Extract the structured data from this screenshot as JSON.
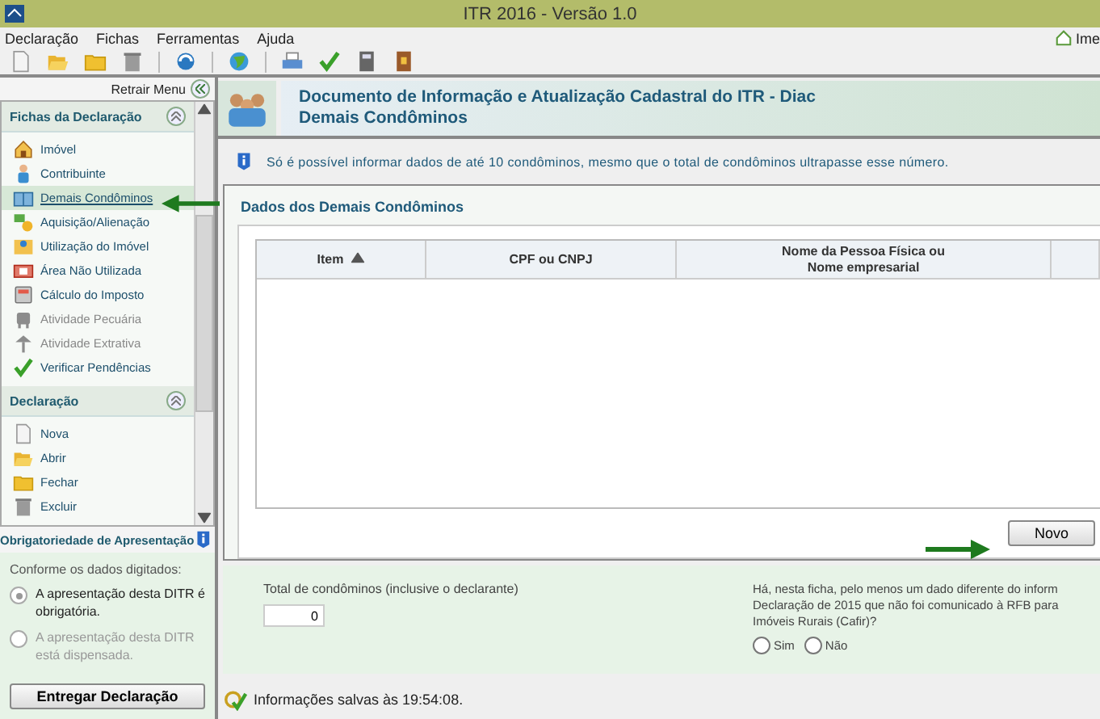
{
  "window": {
    "title": "ITR 2016 - Versão 1.0"
  },
  "menu": [
    "Declaração",
    "Fichas",
    "Ferramentas",
    "Ajuda"
  ],
  "home_link": "Ime",
  "sidebar": {
    "collapse_label": "Retrair Menu",
    "sections": [
      {
        "title": "Fichas da Declaração",
        "items": [
          {
            "label": "Imóvel",
            "selected": false,
            "disabled": false
          },
          {
            "label": "Contribuinte",
            "selected": false,
            "disabled": false
          },
          {
            "label": "Demais Condôminos",
            "selected": true,
            "disabled": false
          },
          {
            "label": "Aquisição/Alienação",
            "selected": false,
            "disabled": false
          },
          {
            "label": "Utilização do Imóvel",
            "selected": false,
            "disabled": false
          },
          {
            "label": "Área Não Utilizada",
            "selected": false,
            "disabled": false
          },
          {
            "label": "Cálculo do Imposto",
            "selected": false,
            "disabled": false
          },
          {
            "label": "Atividade Pecuária",
            "selected": false,
            "disabled": true
          },
          {
            "label": "Atividade Extrativa",
            "selected": false,
            "disabled": true
          },
          {
            "label": "Verificar Pendências",
            "selected": false,
            "disabled": false
          }
        ]
      },
      {
        "title": "Declaração",
        "items": [
          {
            "label": "Nova",
            "selected": false,
            "disabled": false
          },
          {
            "label": "Abrir",
            "selected": false,
            "disabled": false
          },
          {
            "label": "Fechar",
            "selected": false,
            "disabled": false
          },
          {
            "label": "Excluir",
            "selected": false,
            "disabled": false
          }
        ]
      }
    ]
  },
  "obligation": {
    "title": "Obrigatoriedade de Apresentação",
    "intro": "Conforme os dados digitados:",
    "options": [
      {
        "label": "A apresentação desta DITR é obrigatória.",
        "selected": true,
        "disabled": false
      },
      {
        "label": "A apresentação desta DITR está dispensada.",
        "selected": false,
        "disabled": true
      }
    ],
    "button": "Entregar Declaração"
  },
  "header": {
    "title": "Documento de Informação e Atualização Cadastral do ITR - Diac",
    "subtitle": "Demais Condôminos"
  },
  "notice": "Só é possível informar dados de até 10 condôminos, mesmo que o total de condôminos ultrapasse esse número.",
  "panel": {
    "title": "Dados dos Demais Condôminos",
    "table": {
      "columns": [
        {
          "label": "Item",
          "sorted": true
        },
        {
          "label": "CPF ou CNPJ",
          "sorted": false
        },
        {
          "label": "Nome da Pessoa Física ou\nNome empresarial",
          "sorted": false
        }
      ]
    },
    "new_button": "Novo"
  },
  "footer": {
    "total_label": "Total de condôminos (inclusive o declarante)",
    "total_value": "0",
    "question_lines": [
      "Há, nesta ficha, pelo menos um dado diferente do inform",
      "Declaração de 2015 que não foi comunicado à RFB para",
      "Imóveis Rurais (Cafir)?"
    ],
    "options": [
      {
        "label": "Sim",
        "selected": false
      },
      {
        "label": "Não",
        "selected": false
      }
    ]
  },
  "status": "Informações salvas às 19:54:08."
}
